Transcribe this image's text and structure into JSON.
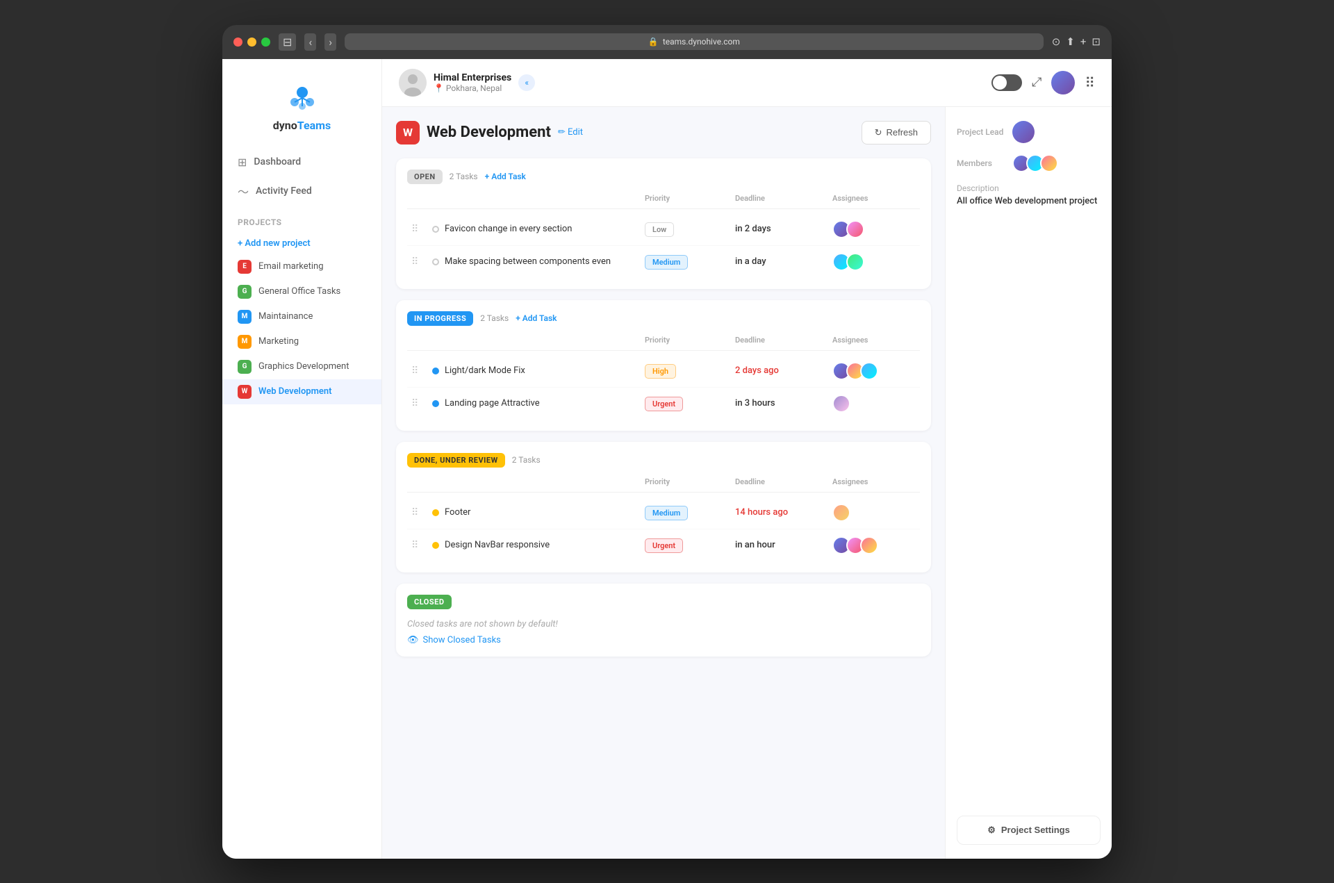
{
  "browser": {
    "url": "teams.dynohive.com",
    "nav_back": "‹",
    "nav_forward": "›"
  },
  "topbar": {
    "org_name": "Himal Enterprises",
    "org_location": "📍 Pokhara, Nepal",
    "collapse_icon": "«"
  },
  "sidebar": {
    "logo_letters": "dyno",
    "logo_letters2": "Teams",
    "nav_items": [
      {
        "id": "dashboard",
        "label": "Dashboard",
        "icon": "⊞"
      },
      {
        "id": "activity-feed",
        "label": "Activity Feed",
        "icon": "∿"
      }
    ],
    "projects_title": "Projects",
    "add_project_label": "+ Add new project",
    "projects": [
      {
        "id": "email-marketing",
        "label": "Email marketing",
        "initial": "E",
        "color": "#e53935"
      },
      {
        "id": "general-office-tasks",
        "label": "General Office Tasks",
        "initial": "G",
        "color": "#4caf50"
      },
      {
        "id": "maintainance",
        "label": "Maintainance",
        "initial": "M",
        "color": "#2196F3"
      },
      {
        "id": "marketing",
        "label": "Marketing",
        "initial": "M",
        "color": "#ff9800"
      },
      {
        "id": "graphics-development",
        "label": "Graphics Development",
        "initial": "G",
        "color": "#4caf50"
      },
      {
        "id": "web-development",
        "label": "Web Development",
        "initial": "W",
        "color": "#e53935",
        "active": true
      }
    ]
  },
  "project": {
    "logo_initial": "W",
    "logo_color": "#e53935",
    "name": "Web Development",
    "edit_label": "✏ Edit",
    "refresh_label": "Refresh",
    "description": "All office Web development project"
  },
  "sections": {
    "open": {
      "badge": "OPEN",
      "count": "2 Tasks",
      "add_label": "+ Add Task",
      "col_priority": "Priority",
      "col_deadline": "Deadline",
      "col_assignees": "Assignees",
      "tasks": [
        {
          "name": "Favicon change in every section",
          "priority": "Low",
          "priority_class": "priority-low",
          "deadline": "in 2 days",
          "deadline_class": "",
          "num_avatars": 2
        },
        {
          "name": "Make spacing between components even",
          "priority": "Medium",
          "priority_class": "priority-medium",
          "deadline": "in a day",
          "deadline_class": "",
          "num_avatars": 2
        }
      ]
    },
    "in_progress": {
      "badge": "IN PROGRESS",
      "count": "2 Tasks",
      "add_label": "+ Add Task",
      "col_priority": "Priority",
      "col_deadline": "Deadline",
      "col_assignees": "Assignees",
      "tasks": [
        {
          "name": "Light/dark Mode Fix",
          "priority": "High",
          "priority_class": "priority-high",
          "deadline": "2 days ago",
          "deadline_class": "deadline-overdue",
          "num_avatars": 3
        },
        {
          "name": "Landing page Attractive",
          "priority": "Urgent",
          "priority_class": "priority-urgent",
          "deadline": "in 3 hours",
          "deadline_class": "",
          "num_avatars": 1
        }
      ]
    },
    "done_review": {
      "badge": "DONE, UNDER REVIEW",
      "count": "2 Tasks",
      "col_priority": "Priority",
      "col_deadline": "Deadline",
      "col_assignees": "Assignees",
      "tasks": [
        {
          "name": "Footer",
          "priority": "Medium",
          "priority_class": "priority-medium",
          "deadline": "14 hours ago",
          "deadline_class": "deadline-overdue",
          "num_avatars": 1
        },
        {
          "name": "Design NavBar responsive",
          "priority": "Urgent",
          "priority_class": "priority-urgent",
          "deadline": "in an hour",
          "deadline_class": "",
          "num_avatars": 3
        }
      ]
    },
    "closed": {
      "badge": "CLOSED",
      "closed_message": "Closed tasks are not shown by default!",
      "show_closed_label": "Show Closed Tasks"
    }
  },
  "right_panel": {
    "project_lead_label": "Project Lead",
    "members_label": "Members",
    "description_label": "Description",
    "description_text": "All office Web development project",
    "settings_label": "Project Settings"
  }
}
